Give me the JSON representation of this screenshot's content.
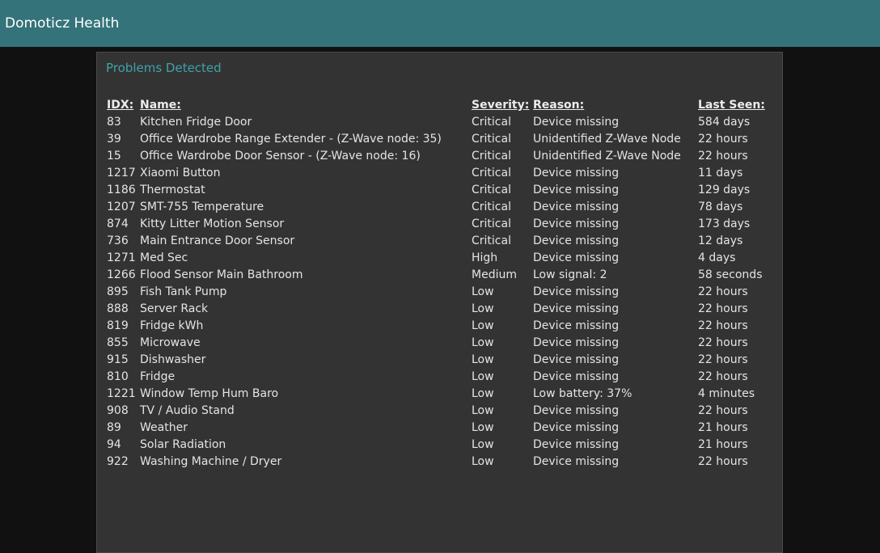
{
  "app": {
    "title": "Domoticz Health"
  },
  "panel": {
    "title": "Problems Detected"
  },
  "table": {
    "headers": {
      "idx": "IDX:",
      "name": "Name:",
      "severity": "Severity:",
      "reason": "Reason:",
      "last_seen": "Last Seen:"
    },
    "rows": [
      {
        "idx": "83",
        "name": "Kitchen Fridge Door",
        "severity": "Critical",
        "reason": "Device missing",
        "last_seen": "584 days"
      },
      {
        "idx": "39",
        "name": "Office Wardrobe Range Extender - (Z-Wave node: 35)",
        "severity": "Critical",
        "reason": "Unidentified Z-Wave Node",
        "last_seen": "22 hours"
      },
      {
        "idx": "15",
        "name": "Office Wardrobe Door Sensor - (Z-Wave node: 16)",
        "severity": "Critical",
        "reason": "Unidentified Z-Wave Node",
        "last_seen": "22 hours"
      },
      {
        "idx": "1217",
        "name": "Xiaomi Button",
        "severity": "Critical",
        "reason": "Device missing",
        "last_seen": "11 days"
      },
      {
        "idx": "1186",
        "name": "Thermostat",
        "severity": "Critical",
        "reason": "Device missing",
        "last_seen": "129 days"
      },
      {
        "idx": "1207",
        "name": "SMT-755 Temperature",
        "severity": "Critical",
        "reason": "Device missing",
        "last_seen": "78 days"
      },
      {
        "idx": "874",
        "name": "Kitty Litter Motion Sensor",
        "severity": "Critical",
        "reason": "Device missing",
        "last_seen": "173 days"
      },
      {
        "idx": "736",
        "name": "Main Entrance Door Sensor",
        "severity": "Critical",
        "reason": "Device missing",
        "last_seen": "12 days"
      },
      {
        "idx": "1271",
        "name": "Med Sec",
        "severity": "High",
        "reason": "Device missing",
        "last_seen": "4 days"
      },
      {
        "idx": "1266",
        "name": "Flood Sensor Main Bathroom",
        "severity": "Medium",
        "reason": "Low signal: 2",
        "last_seen": "58 seconds"
      },
      {
        "idx": "895",
        "name": "Fish Tank Pump",
        "severity": "Low",
        "reason": "Device missing",
        "last_seen": "22 hours"
      },
      {
        "idx": "888",
        "name": "Server Rack",
        "severity": "Low",
        "reason": "Device missing",
        "last_seen": "22 hours"
      },
      {
        "idx": "819",
        "name": "Fridge kWh",
        "severity": "Low",
        "reason": "Device missing",
        "last_seen": "22 hours"
      },
      {
        "idx": "855",
        "name": "Microwave",
        "severity": "Low",
        "reason": "Device missing",
        "last_seen": "22 hours"
      },
      {
        "idx": "915",
        "name": "Dishwasher",
        "severity": "Low",
        "reason": "Device missing",
        "last_seen": "22 hours"
      },
      {
        "idx": "810",
        "name": "Fridge",
        "severity": "Low",
        "reason": "Device missing",
        "last_seen": "22 hours"
      },
      {
        "idx": "1221",
        "name": "Window Temp Hum Baro",
        "severity": "Low",
        "reason": "Low battery: 37%",
        "last_seen": "4 minutes"
      },
      {
        "idx": "908",
        "name": "TV / Audio Stand",
        "severity": "Low",
        "reason": "Device missing",
        "last_seen": "22 hours"
      },
      {
        "idx": "89",
        "name": "Weather",
        "severity": "Low",
        "reason": "Device missing",
        "last_seen": "21 hours"
      },
      {
        "idx": "94",
        "name": "Solar Radiation",
        "severity": "Low",
        "reason": "Device missing",
        "last_seen": "21 hours"
      },
      {
        "idx": "922",
        "name": "Washing Machine / Dryer",
        "severity": "Low",
        "reason": "Device missing",
        "last_seen": "22 hours"
      }
    ]
  },
  "colors": {
    "header_bar": "#347379",
    "page_background": "#111111",
    "panel_background": "#333333",
    "panel_title": "#3fa2ab",
    "text": "#e4e4e4"
  }
}
